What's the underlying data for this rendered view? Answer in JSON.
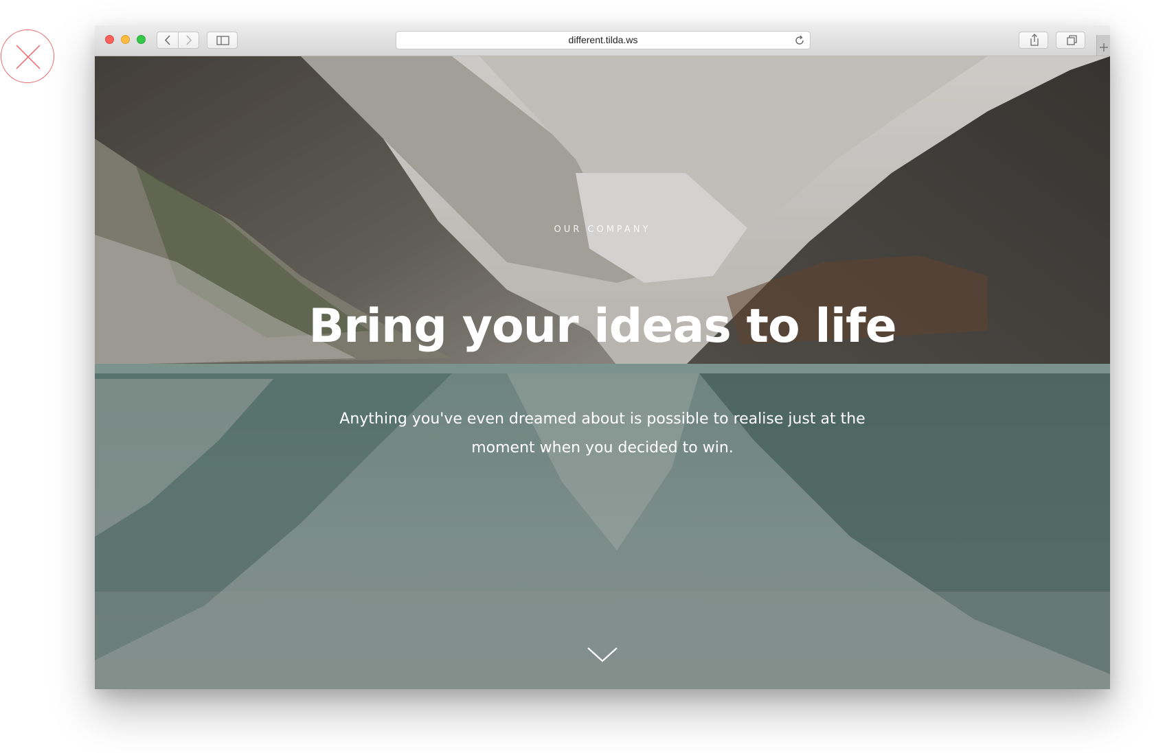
{
  "browser": {
    "url": "different.tilda.ws"
  },
  "hero": {
    "eyebrow": "OUR COMPANY",
    "title": "Bring your ideas to life",
    "subtitle_line1": "Anything you've even dreamed about is possible to realise just at the",
    "subtitle_line2": "moment when you decided to win."
  },
  "icons": {
    "close": "close-icon",
    "back": "chevron-left-icon",
    "forward": "chevron-right-icon",
    "sidebar": "sidebar-icon",
    "reload": "reload-icon",
    "share": "share-icon",
    "tabs": "tabs-icon",
    "new_tab": "plus-icon",
    "scroll": "chevron-down-icon"
  },
  "colors": {
    "close_accent": "#e8686a",
    "traffic_red": "#fc605b",
    "traffic_yellow": "#fdbc40",
    "traffic_green": "#34c84a"
  }
}
